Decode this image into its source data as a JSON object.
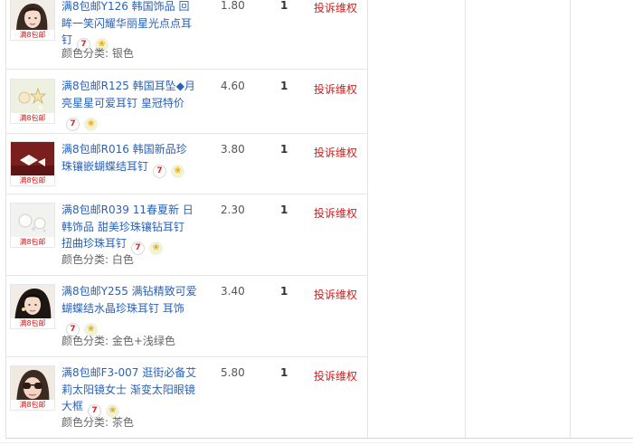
{
  "thumb_caption": "满8包邮",
  "complain_label": "投诉维权",
  "badges": {
    "first": "7",
    "second": "❀"
  },
  "orders": [
    {
      "title": "满8包邮Y126 韩国饰品 回眸一笑闪耀华丽星光点点耳钉",
      "color_spec": "颜色分类: 银色",
      "price": "1.80",
      "qty": "1"
    },
    {
      "title": "满8包邮R125 韩国耳坠◆月亮星星可爱耳钉 皇冠特价",
      "color_spec": "",
      "price": "4.60",
      "qty": "1"
    },
    {
      "title": "满8包邮R016 韩国新品珍珠镶嵌蝴蝶结耳钉",
      "color_spec": "",
      "price": "3.80",
      "qty": "1"
    },
    {
      "title": "满8包邮R039 11春夏新 日韩饰品 甜美珍珠镶钻耳钉 扭曲珍珠耳钉",
      "color_spec": "颜色分类: 白色",
      "price": "2.30",
      "qty": "1"
    },
    {
      "title": "满8包邮Y255 满钻精致可爱蝴蝶结水晶珍珠耳钉 耳饰",
      "color_spec": "颜色分类: 金色+浅绿色",
      "price": "3.40",
      "qty": "1"
    },
    {
      "title": "满8包邮F3-007 逛街必备艾莉太阳镜女士 渐变太阳眼镜 大框",
      "color_spec": "颜色分类: 茶色",
      "price": "5.80",
      "qty": "1"
    }
  ]
}
